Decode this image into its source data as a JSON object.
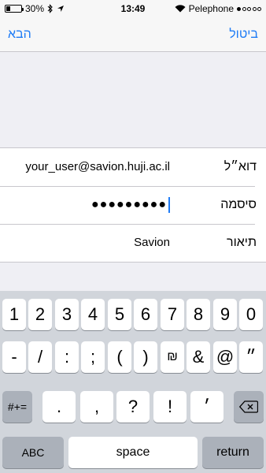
{
  "status_bar": {
    "battery_percent": "30%",
    "battery_level": 0.3,
    "time": "13:49",
    "carrier": "Pelephone",
    "signal_bars": 1,
    "icons": [
      "battery-icon",
      "bluetooth-icon",
      "location-arrow-icon",
      "wifi-icon",
      "signal-dots-icon"
    ]
  },
  "nav": {
    "left_label": "הבא",
    "right_label": "ביטול"
  },
  "form": {
    "email_label": "דוא״ל",
    "email_value": "your_user@savion.huji.ac.il",
    "password_label": "סיסמה",
    "password_value": "●●●●●●●●●",
    "description_label": "תיאור",
    "description_value": "Savion"
  },
  "keyboard": {
    "row1": [
      "1",
      "2",
      "3",
      "4",
      "5",
      "6",
      "7",
      "8",
      "9",
      "0"
    ],
    "row2": [
      "-",
      "/",
      ":",
      ";",
      "(",
      ")",
      "₪",
      "&",
      "@",
      "״"
    ],
    "row3_left": "#+=",
    "row3": [
      ".",
      ",",
      "?",
      "!",
      "׳"
    ],
    "row3_right": "delete",
    "abc_label": "ABC",
    "space_label": "space",
    "return_label": "return"
  },
  "colors": {
    "accent": "#1f7cf6",
    "background": "#efeff4",
    "keyboard_bg": "#d1d5db",
    "dark_key": "#abb1ba"
  }
}
